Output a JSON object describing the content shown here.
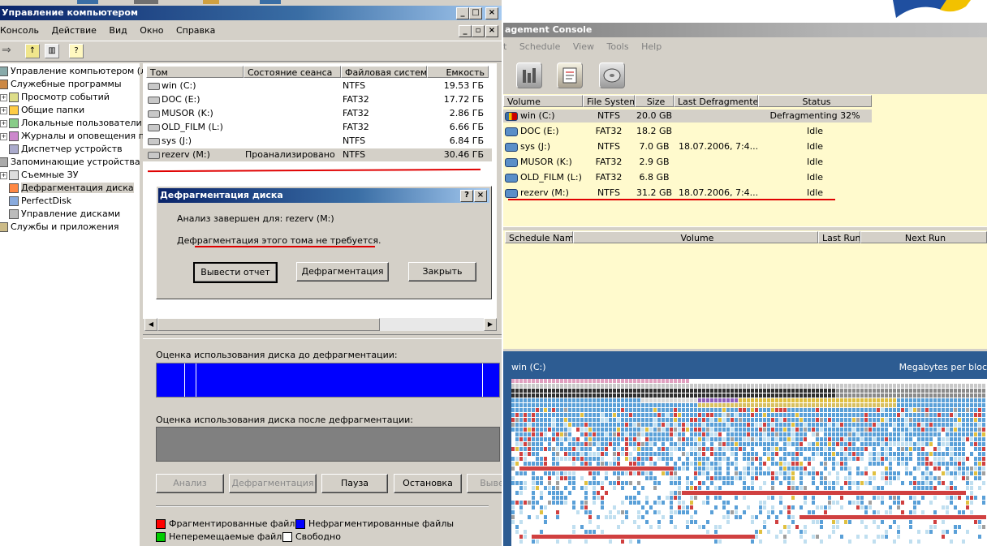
{
  "left_window": {
    "title": "Управление компьютером",
    "menu": [
      "Консоль",
      "Действие",
      "Вид",
      "Окно",
      "Справка"
    ],
    "tree": [
      {
        "label": "Управление компьютером (локаль",
        "indent": 0,
        "icon": "computer-icon"
      },
      {
        "label": "Служебные программы",
        "indent": 1,
        "icon": "tools-icon"
      },
      {
        "label": "Просмотр событий",
        "indent": 2,
        "icon": "event-viewer-icon"
      },
      {
        "label": "Общие папки",
        "indent": 2,
        "icon": "folder-icon"
      },
      {
        "label": "Локальные пользователи и",
        "indent": 2,
        "icon": "users-icon"
      },
      {
        "label": "Журналы и оповещения пр",
        "indent": 2,
        "icon": "logs-icon"
      },
      {
        "label": "Диспетчер устройств",
        "indent": 2,
        "icon": "device-manager-icon"
      },
      {
        "label": "Запоминающие устройства",
        "indent": 1,
        "icon": "storage-icon"
      },
      {
        "label": "Съемные ЗУ",
        "indent": 2,
        "icon": "removable-icon"
      },
      {
        "label": "Дефрагментация диска",
        "indent": 2,
        "icon": "defrag-icon",
        "selected": true
      },
      {
        "label": "PerfectDisk",
        "indent": 2,
        "icon": "perfectdisk-icon"
      },
      {
        "label": "Управление дисками",
        "indent": 2,
        "icon": "disk-mgmt-icon"
      },
      {
        "label": "Службы и приложения",
        "indent": 1,
        "icon": "services-icon"
      }
    ],
    "volume_table": {
      "columns": [
        "Том",
        "Состояние сеанса",
        "Файловая система",
        "Емкость"
      ],
      "rows": [
        [
          "win (C:)",
          "",
          "NTFS",
          "19.53 ГБ"
        ],
        [
          "DOC (E:)",
          "",
          "FAT32",
          "17.72 ГБ"
        ],
        [
          "MUSOR (K:)",
          "",
          "FAT32",
          "2.86 ГБ"
        ],
        [
          "OLD_FILM (L:)",
          "",
          "FAT32",
          "6.66 ГБ"
        ],
        [
          "sys (J:)",
          "",
          "NTFS",
          "6.84 ГБ"
        ],
        [
          "rezerv (M:)",
          "Проанализировано",
          "NTFS",
          "30.46 ГБ"
        ]
      ]
    },
    "dialog": {
      "title": "Дефрагментация диска",
      "line1": "Анализ завершен для: rezerv (M:)",
      "line2": "Дефрагментация этого тома не требуется.",
      "buttons": [
        "Вывести отчет",
        "Дефрагментация",
        "Закрыть"
      ]
    },
    "before_label": "Оценка использования диска до дефрагментации:",
    "after_label": "Оценка использования диска после дефрагментации:",
    "action_buttons": [
      "Анализ",
      "Дефрагментация",
      "Пауза",
      "Остановка",
      "Выве"
    ],
    "legend": [
      "Фрагментированные файлы",
      "Нефрагментированные файлы",
      "Неперемещаемые файлы",
      "Свободно"
    ],
    "colors": {
      "fragmented": "#ff0000",
      "contiguous": "#0000ff",
      "unmovable": "#00cc00",
      "free": "#ffffff"
    }
  },
  "right_window": {
    "title": "agement Console",
    "menu": [
      "t",
      "Schedule",
      "View",
      "Tools",
      "Help"
    ],
    "volume_table": {
      "columns": [
        "Volume",
        "File System",
        "Size",
        "Last Defragmented",
        "Status"
      ],
      "rows": [
        [
          "win (C:)",
          "NTFS",
          "20.0 GB",
          "",
          "Defragmenting 32%"
        ],
        [
          "DOC (E:)",
          "FAT32",
          "18.2 GB",
          "",
          "Idle"
        ],
        [
          "sys (J:)",
          "NTFS",
          "7.0 GB",
          "18.07.2006, 7:4...",
          "Idle"
        ],
        [
          "MUSOR (K:)",
          "FAT32",
          "2.9 GB",
          "",
          "Idle"
        ],
        [
          "OLD_FILM (L:)",
          "FAT32",
          "6.8 GB",
          "",
          "Idle"
        ],
        [
          "rezerv (M:)",
          "NTFS",
          "31.2 GB",
          "18.07.2006, 7:4...",
          "Idle"
        ]
      ]
    },
    "schedule_table": {
      "columns": [
        "Schedule Name",
        "Volume",
        "Last Run",
        "Next Run"
      ]
    },
    "map": {
      "volume": "win (C:)",
      "units": "Megabytes per bloc"
    }
  }
}
